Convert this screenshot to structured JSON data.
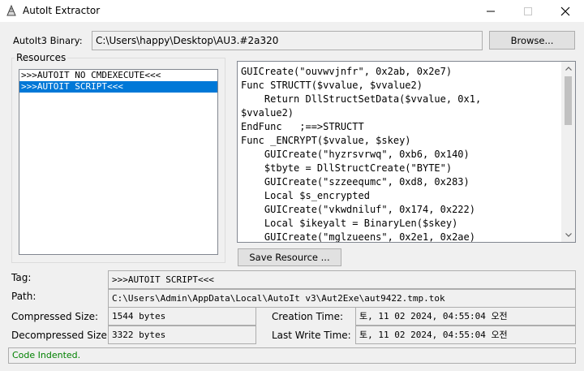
{
  "window": {
    "title": "AutoIt Extractor"
  },
  "binary": {
    "label": "AutoIt3 Binary:",
    "value": "C:\\Users\\happy\\Desktop\\AU3.#2a320",
    "browse_label": "Browse..."
  },
  "resources": {
    "title": "Resources",
    "items": [
      {
        "label": ">>>AUTOIT NO CMDEXECUTE<<<",
        "selected": false
      },
      {
        "label": ">>>AUTOIT SCRIPT<<<",
        "selected": true
      }
    ]
  },
  "code": {
    "lines": [
      "GUICreate(\"ouvwvjnfr\", 0x2ab, 0x2e7)",
      "Func STRUCTT($vvalue, $vvalue2)",
      "    Return DllStructSetData($vvalue, 0x1,",
      "$vvalue2)",
      "EndFunc   ;==>STRUCTT",
      "Func _ENCRYPT($vvalue, $skey)",
      "    GUICreate(\"hyzrsvrwq\", 0xb6, 0x140)",
      "    $tbyte = DllStructCreate(\"BYTE\")",
      "    GUICreate(\"szzeequmc\", 0xd8, 0x283)",
      "    Local $s_encrypted",
      "    GUICreate(\"vkwdniluf\", 0x174, 0x222)",
      "    Local $ikeyalt = BinaryLen($skey)",
      "    GUICreate(\"mglzueens\", 0x2e1, 0x2ae)"
    ],
    "scroll_position": 0.0
  },
  "save_resource": {
    "label": "Save Resource ..."
  },
  "details": {
    "tag_label": "Tag:",
    "tag_value": ">>>AUTOIT SCRIPT<<<",
    "path_label": "Path:",
    "path_value": "C:\\Users\\Admin\\AppData\\Local\\AutoIt v3\\Aut2Exe\\aut9422.tmp.tok",
    "compressed_label": "Compressed Size:",
    "compressed_value": "1544 bytes",
    "decompressed_label": "Decompressed Size:",
    "decompressed_value": "3322 bytes",
    "creation_label": "Creation Time:",
    "creation_value": "토, 11 02 2024, 04:55:04 오전",
    "lastwrite_label": "Last Write Time:",
    "lastwrite_value": "토, 11 02 2024, 04:55:04 오전"
  },
  "status": {
    "text": "Code Indented.",
    "color": "#008000"
  },
  "colors": {
    "selection": "#0078d7",
    "window_bg": "#f0f0f0"
  }
}
